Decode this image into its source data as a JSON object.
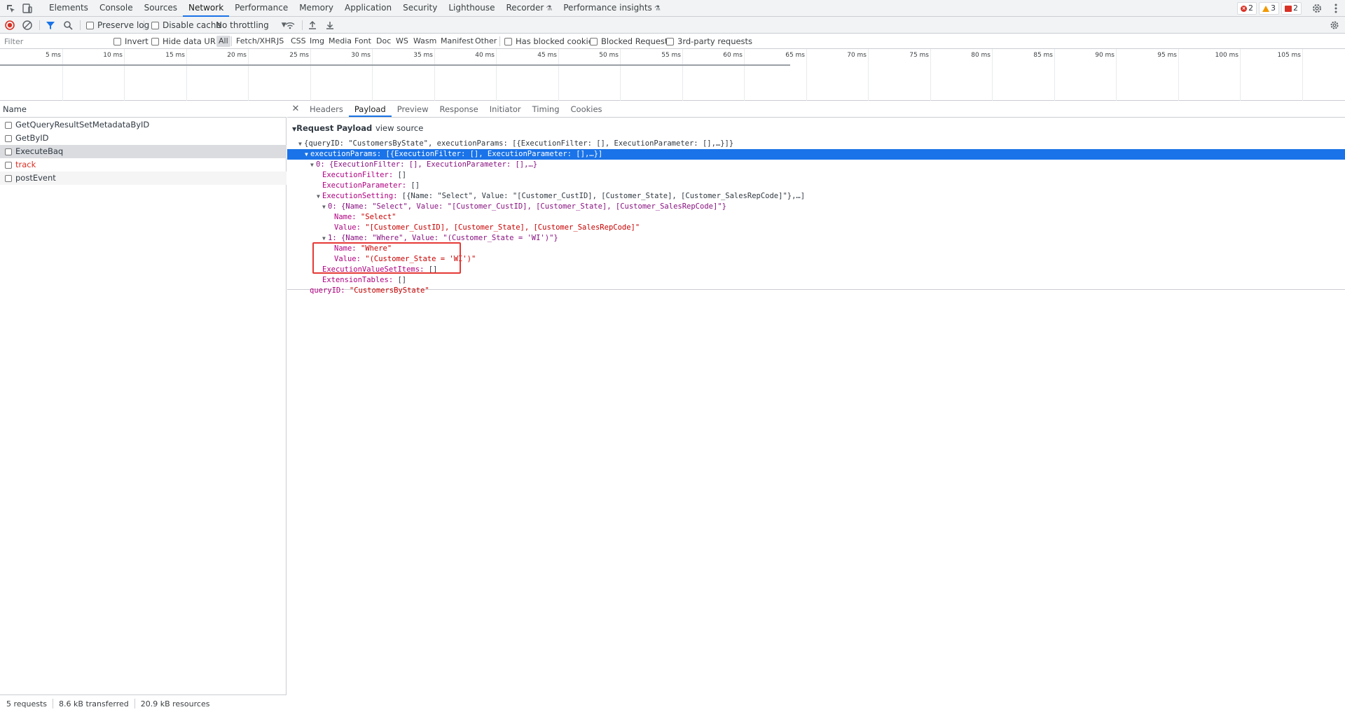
{
  "topbar": {
    "tabs": [
      "Elements",
      "Console",
      "Sources",
      "Network",
      "Performance",
      "Memory",
      "Application",
      "Security",
      "Lighthouse",
      "Recorder",
      "Performance insights"
    ],
    "active_tab": "Network",
    "errors": "2",
    "warnings": "3",
    "issues": "2"
  },
  "toolbar": {
    "preserve_log": "Preserve log",
    "disable_cache": "Disable cache",
    "throttling": "No throttling"
  },
  "filterbar": {
    "placeholder": "Filter",
    "invert": "Invert",
    "hide_data_urls": "Hide data URLs",
    "types": [
      "All",
      "Fetch/XHR",
      "JS",
      "CSS",
      "Img",
      "Media",
      "Font",
      "Doc",
      "WS",
      "Wasm",
      "Manifest",
      "Other"
    ],
    "active_type": "All",
    "has_blocked_cookies": "Has blocked cookies",
    "blocked_requests": "Blocked Requests",
    "third_party": "3rd-party requests"
  },
  "overview": {
    "ticks": [
      "5 ms",
      "10 ms",
      "15 ms",
      "20 ms",
      "25 ms",
      "30 ms",
      "35 ms",
      "40 ms",
      "45 ms",
      "50 ms",
      "55 ms",
      "60 ms",
      "65 ms",
      "70 ms",
      "75 ms",
      "80 ms",
      "85 ms",
      "90 ms",
      "95 ms",
      "100 ms",
      "105 ms"
    ]
  },
  "requests": {
    "header": "Name",
    "rows": [
      {
        "name": "GetQueryResultSetMetadataByID"
      },
      {
        "name": "GetByID"
      },
      {
        "name": "ExecuteBaq"
      },
      {
        "name": "track"
      },
      {
        "name": "postEvent"
      }
    ],
    "selected": "ExecuteBaq",
    "failed": "track"
  },
  "status": {
    "requests": "5 requests",
    "transferred": "8.6 kB transferred",
    "resources": "20.9 kB resources"
  },
  "detail": {
    "tabs": [
      "Headers",
      "Payload",
      "Preview",
      "Response",
      "Initiator",
      "Timing",
      "Cookies"
    ],
    "active_tab": "Payload",
    "payload_title": "Request Payload",
    "view_source": "view source",
    "tree": {
      "root": "{queryID: \"CustomersByState\", executionParams: [{ExecutionFilter: [], ExecutionParameter: [],…}]}",
      "exec_params_key": "executionParams:",
      "exec_params_val": " [{ExecutionFilter: [], ExecutionParameter: [],…}]",
      "item0": "0: {ExecutionFilter: [], ExecutionParameter: [],…}",
      "exec_filter_key": "ExecutionFilter:",
      "exec_filter_val": " []",
      "exec_param_key": "ExecutionParameter:",
      "exec_param_val": " []",
      "exec_setting_key": "ExecutionSetting:",
      "exec_setting_val": " [{Name: \"Select\", Value: \"[Customer_CustID], [Customer_State], [Customer_SalesRepCode]\"},…]",
      "setting0": "0: {Name: \"Select\", Value: \"[Customer_CustID], [Customer_State], [Customer_SalesRepCode]\"}",
      "s0_name_key": "Name:",
      "s0_name_val": " \"Select\"",
      "s0_value_key": "Value:",
      "s0_value_val": " \"[Customer_CustID], [Customer_State], [Customer_SalesRepCode]\"",
      "setting1": "1: {Name: \"Where\", Value: \"(Customer_State = 'WI')\"}",
      "s1_name_key": "Name:",
      "s1_name_val": " \"Where\"",
      "s1_value_key": "Value:",
      "s1_value_val": " \"(Customer_State = 'WI')\"",
      "exec_vsi_key": "ExecutionValueSetItems:",
      "exec_vsi_val": " []",
      "ext_tables_key": "ExtensionTables:",
      "ext_tables_val": " []",
      "query_id_key": "queryID:",
      "query_id_val": " \"CustomersByState\""
    }
  },
  "colors": {
    "accent": "#1a73e8",
    "error": "#d93025",
    "warning": "#f29900",
    "highlight_box": "#e53935"
  }
}
